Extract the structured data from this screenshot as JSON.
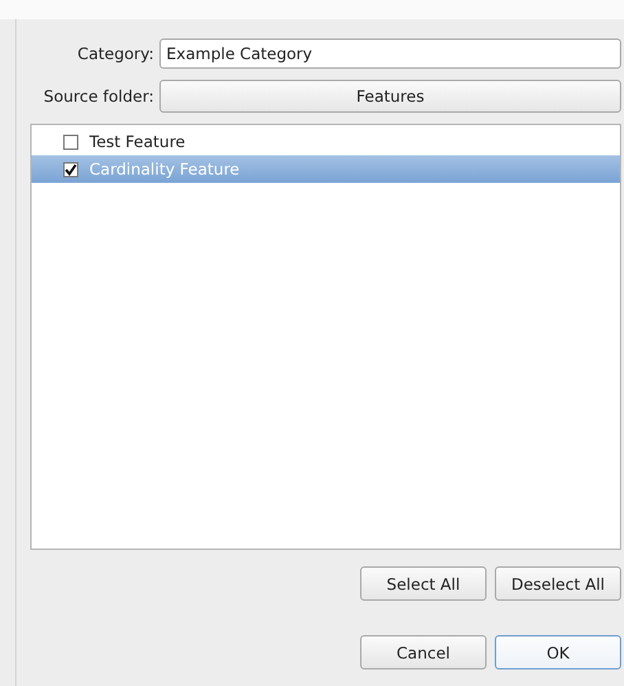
{
  "category": {
    "label": "Category:",
    "value": "Example Category"
  },
  "source_folder": {
    "label": "Source folder:",
    "button": "Features"
  },
  "features": [
    {
      "label": "Test Feature",
      "checked": false,
      "selected": false
    },
    {
      "label": "Cardinality Feature",
      "checked": true,
      "selected": true
    }
  ],
  "list_buttons": [
    "Select All",
    "Deselect All"
  ],
  "dialog_buttons": [
    {
      "label": "Cancel",
      "default": false
    },
    {
      "label": "OK",
      "default": true
    }
  ]
}
